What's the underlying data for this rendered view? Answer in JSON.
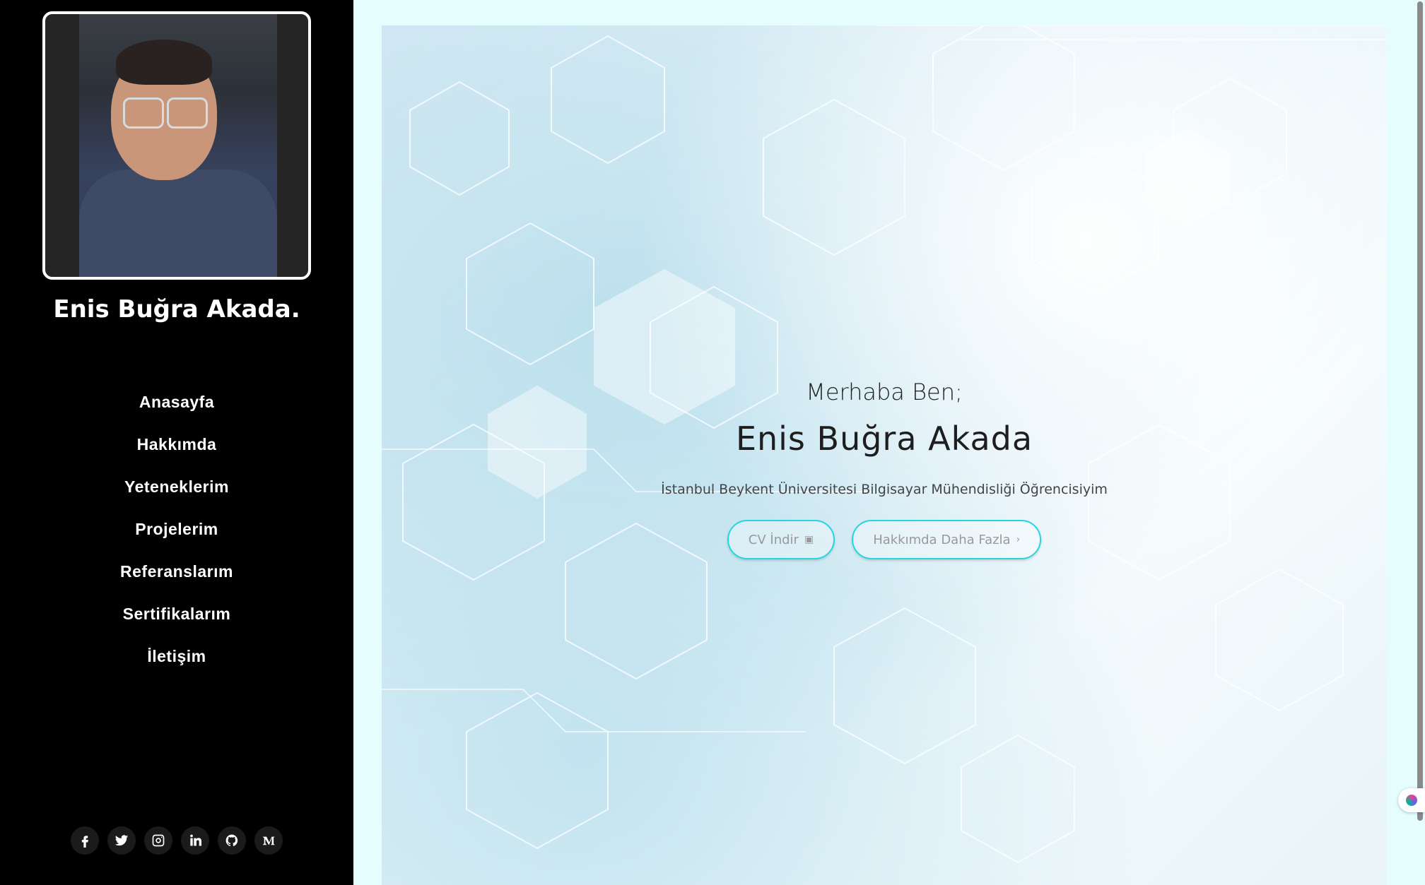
{
  "sidebar": {
    "name": "Enis Buğra Akada.",
    "nav": [
      {
        "label": "Anasayfa"
      },
      {
        "label": "Hakkımda"
      },
      {
        "label": "Yeteneklerim"
      },
      {
        "label": "Projelerim"
      },
      {
        "label": "Referanslarım"
      },
      {
        "label": "Sertifikalarım"
      },
      {
        "label": "İletişim"
      }
    ],
    "socials": [
      "facebook-icon",
      "twitter-icon",
      "instagram-icon",
      "linkedin-icon",
      "github-icon",
      "medium-icon"
    ]
  },
  "hero": {
    "greeting": "Merhaba Ben;",
    "name": "Enis Buğra Akada",
    "tagline": "İstanbul Beykent Üniversitesi Bilgisayar Mühendisliği Öğrencisiyim",
    "cv_button": "CV İndir",
    "more_button": "Hakkımda Daha Fazla"
  },
  "colors": {
    "accent": "#25d5e0",
    "sidebar_bg": "#000000",
    "page_bg": "#e6fdfd"
  }
}
